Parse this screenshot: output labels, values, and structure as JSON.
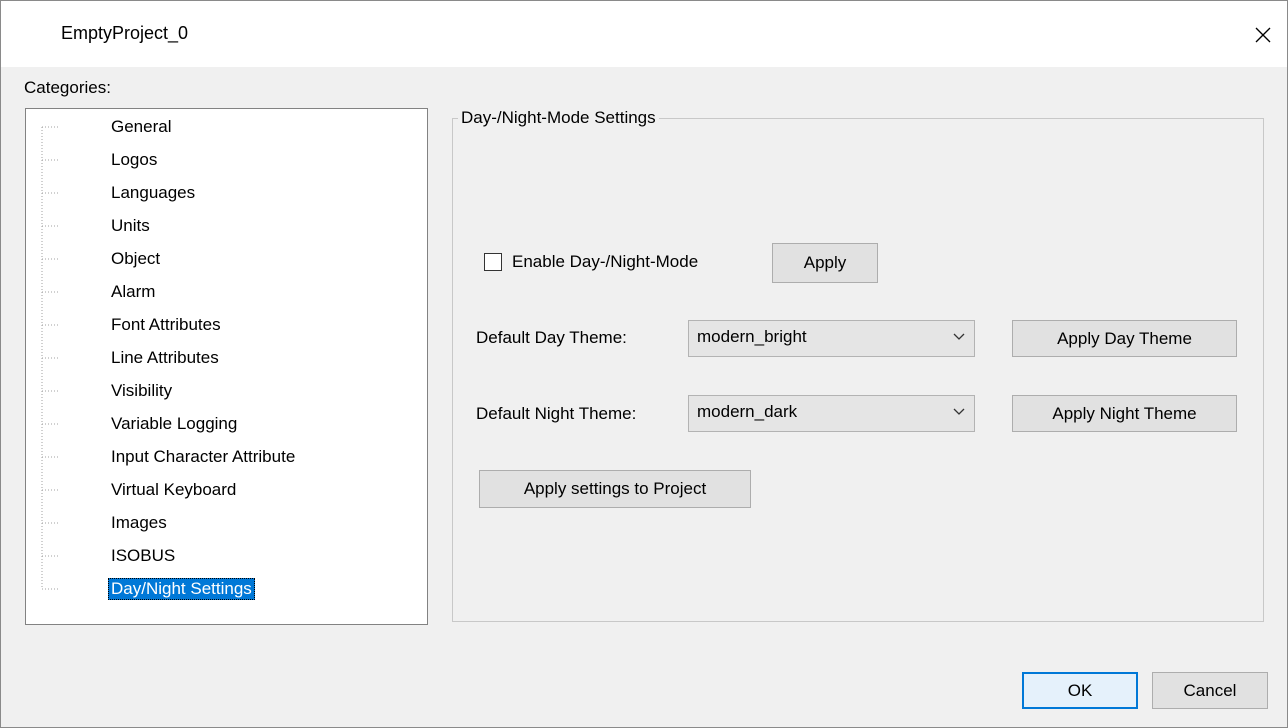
{
  "window": {
    "title": "EmptyProject_0"
  },
  "categories": {
    "label": "Categories:",
    "items": [
      {
        "label": "General"
      },
      {
        "label": "Logos"
      },
      {
        "label": "Languages"
      },
      {
        "label": "Units"
      },
      {
        "label": "Object"
      },
      {
        "label": "Alarm"
      },
      {
        "label": "Font Attributes"
      },
      {
        "label": "Line Attributes"
      },
      {
        "label": "Visibility"
      },
      {
        "label": "Variable Logging"
      },
      {
        "label": "Input Character Attribute"
      },
      {
        "label": "Virtual Keyboard"
      },
      {
        "label": "Images"
      },
      {
        "label": "ISOBUS"
      },
      {
        "label": "Day/Night Settings"
      }
    ],
    "selected_index": 14
  },
  "settings": {
    "group_title": "Day-/Night-Mode Settings",
    "enable_label": "Enable Day-/Night-Mode",
    "enable_checked": false,
    "apply_label": "Apply",
    "day_theme_label": "Default Day Theme:",
    "day_theme_value": "modern_bright",
    "apply_day_label": "Apply Day Theme",
    "night_theme_label": "Default Night Theme:",
    "night_theme_value": "modern_dark",
    "apply_night_label": "Apply Night Theme",
    "apply_project_label": "Apply settings to Project"
  },
  "footer": {
    "ok_label": "OK",
    "cancel_label": "Cancel"
  },
  "colors": {
    "selection": "#0078d7",
    "window_bg": "#f0f0f0"
  }
}
